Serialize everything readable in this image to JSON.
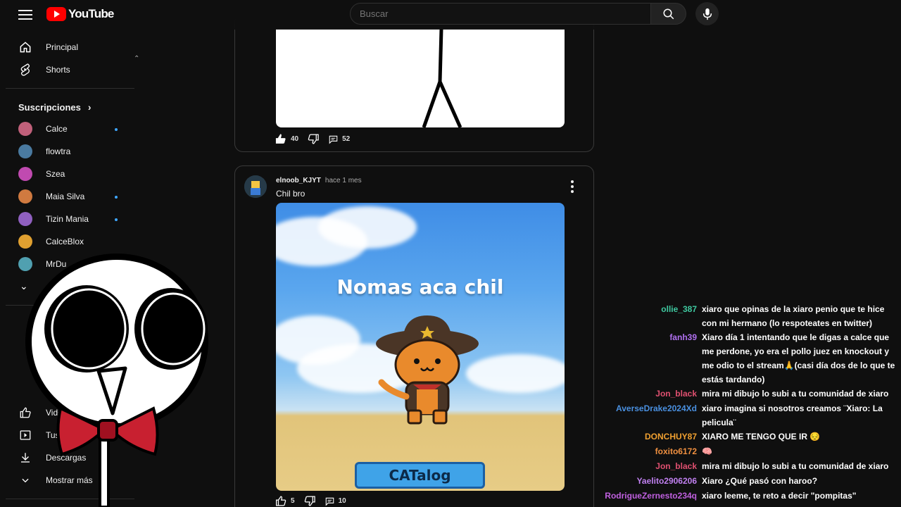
{
  "header": {
    "logo_text": "YouTube",
    "search_placeholder": "Buscar"
  },
  "sidebar": {
    "main": [
      {
        "label": "Principal",
        "icon": "home-icon"
      },
      {
        "label": "Shorts",
        "icon": "shorts-icon"
      }
    ],
    "subscriptions_title": "Suscripciones",
    "subscriptions": [
      {
        "label": "Calce",
        "live": true,
        "color": "#c0607a"
      },
      {
        "label": "flowtra",
        "live": false,
        "color": "#4a7aa0"
      },
      {
        "label": "Szea",
        "live": false,
        "color": "#c04ab0"
      },
      {
        "label": "Maia Silva",
        "live": true,
        "color": "#d07a40"
      },
      {
        "label": "Tizin Mania",
        "live": true,
        "color": "#9060c0"
      },
      {
        "label": "CalceBlox",
        "live": false,
        "color": "#e0a030"
      },
      {
        "label": "MrDu",
        "live": false,
        "color": "#50a0b0"
      }
    ],
    "you_items": [
      {
        "label": "Vide",
        "icon": "thumbs-up-icon"
      },
      {
        "label": "Tus",
        "icon": "video-icon"
      },
      {
        "label": "Descargas",
        "icon": "download-icon"
      },
      {
        "label": "Mostrar más",
        "icon": "chevron-down-icon"
      }
    ]
  },
  "posts": [
    {
      "likes": "40",
      "comments": "52"
    },
    {
      "author": "elnoob_KJYT",
      "time": "hace 1 mes",
      "text": "Chil bro",
      "image_caption": "Nomas aca chil",
      "image_button": "CATalog",
      "likes": "5",
      "comments": "10"
    }
  ],
  "chat": [
    {
      "user": "ollie_387",
      "color": "#3fc9a0",
      "text": "xiaro que opinas de la xiaro penio que te hice con mi hermano (lo respoteates en twitter)"
    },
    {
      "user": "fanh39",
      "color": "#b070f0",
      "text": "Xiaro día 1 intentando que le digas a calce que me perdone, yo era el pollo juez en knockout y me odio to el stream🙏(casi día dos de lo que te estás tardando)"
    },
    {
      "user": "Jon_black",
      "color": "#e05070",
      "text": "mira mi dibujo lo subi a tu comunidad de xiaro"
    },
    {
      "user": "AverseDrake2024Xd",
      "color": "#4a90e0",
      "text": "xiaro imagina si nosotros creamos ¨Xiaro: La pelicula¨"
    },
    {
      "user": "DONCHUY87",
      "color": "#f0a030",
      "text": "XIARO ME TENGO QUE IR 😔"
    },
    {
      "user": "foxito6172",
      "color": "#f09040",
      "text": "🧠"
    },
    {
      "user": "Jon_black",
      "color": "#e05070",
      "text": "mira mi dibujo lo subi a tu comunidad de xiaro"
    },
    {
      "user": "Yaelito2906206",
      "color": "#c080f0",
      "text": "Xiaro ¿Qué pasó con haroo?"
    },
    {
      "user": "RodrigueZernesto234q",
      "color": "#c060e0",
      "text": "xiaro leeme, te reto a decir \"pompitas\""
    }
  ]
}
